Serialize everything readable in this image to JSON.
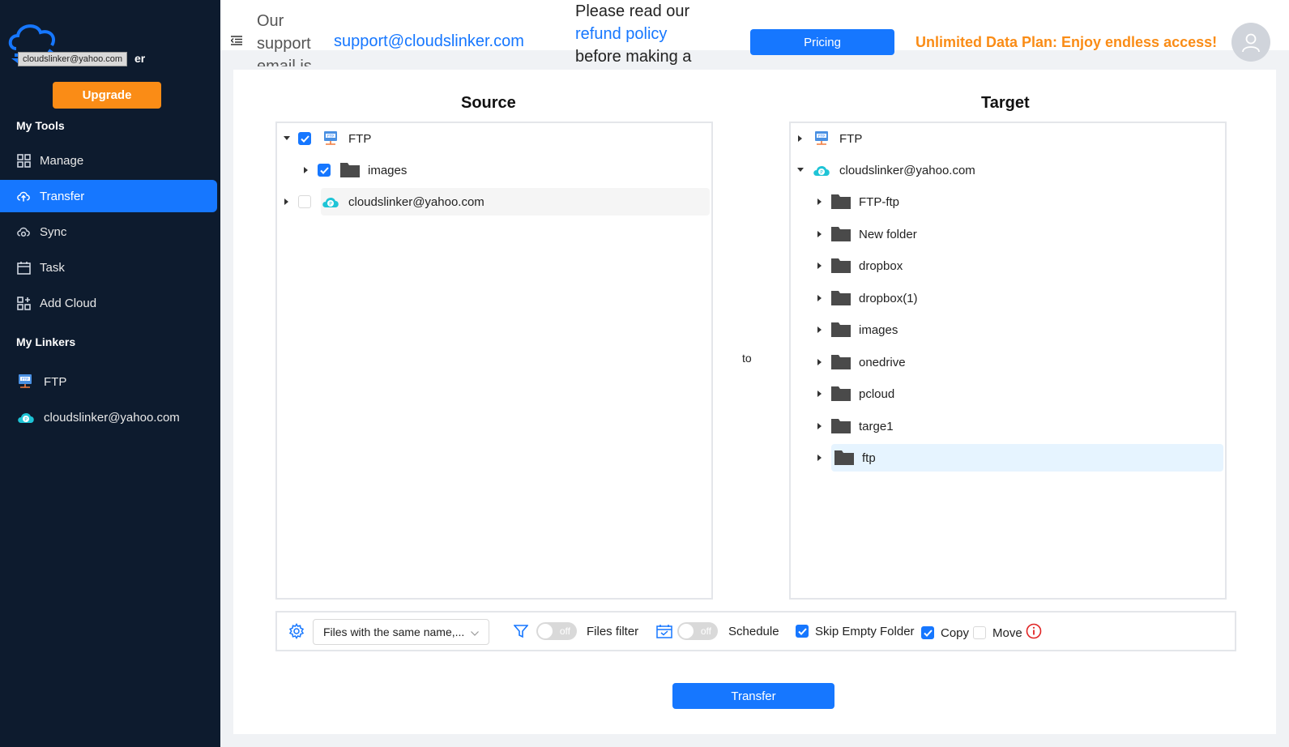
{
  "sidebar": {
    "logo_tooltip": "cloudslinker@yahoo.com",
    "logo_suffix": "er",
    "upgrade_label": "Upgrade",
    "tools_title": "My Tools",
    "nav": [
      {
        "label": "Manage",
        "icon": "grid-icon"
      },
      {
        "label": "Transfer",
        "icon": "cloud-upload-icon",
        "active": true
      },
      {
        "label": "Sync",
        "icon": "cloud-sync-icon"
      },
      {
        "label": "Task",
        "icon": "calendar-icon"
      },
      {
        "label": "Add Cloud",
        "icon": "add-grid-icon"
      }
    ],
    "linkers_title": "My Linkers",
    "linkers": [
      {
        "label": "FTP",
        "icon": "ftp-icon"
      },
      {
        "label": "cloudslinker@yahoo.com",
        "icon": "pcloud-icon"
      }
    ]
  },
  "header": {
    "support_prefix": "Our support email is",
    "support_email": "support@cloudslinker.com",
    "refund_pre": "Please read our",
    "refund_link": "refund policy",
    "refund_post": "before making a",
    "pricing_label": "Pricing",
    "promo": "Unlimited Data Plan: Enjoy endless access!"
  },
  "colors": {
    "accent": "#1677ff",
    "promo": "#fa8c16",
    "sidebar_bg": "#0d1b2e"
  },
  "source": {
    "title": "Source",
    "nodes": [
      {
        "label": "FTP",
        "checked": true,
        "expanded": true,
        "icon": "ftp-icon"
      },
      {
        "label": "images",
        "checked": true,
        "icon": "folder-icon"
      },
      {
        "label": "cloudslinker@yahoo.com",
        "checked": false,
        "icon": "pcloud-icon"
      }
    ]
  },
  "to_label": "to",
  "target": {
    "title": "Target",
    "nodes": [
      {
        "label": "FTP",
        "icon": "ftp-icon"
      },
      {
        "label": "cloudslinker@yahoo.com",
        "icon": "pcloud-icon",
        "expanded": true
      },
      {
        "label": "FTP-ftp",
        "icon": "folder-icon"
      },
      {
        "label": "New folder",
        "icon": "folder-icon"
      },
      {
        "label": "dropbox",
        "icon": "folder-icon"
      },
      {
        "label": "dropbox(1)",
        "icon": "folder-icon"
      },
      {
        "label": "images",
        "icon": "folder-icon"
      },
      {
        "label": "onedrive",
        "icon": "folder-icon"
      },
      {
        "label": "pcloud",
        "icon": "folder-icon"
      },
      {
        "label": "targe1",
        "icon": "folder-icon"
      },
      {
        "label": "ftp",
        "icon": "folder-icon",
        "selected": true
      }
    ]
  },
  "options": {
    "conflict_value": "Files with the same name,...",
    "filter_toggle": "off",
    "filter_label": "Files filter",
    "schedule_toggle": "off",
    "schedule_label": "Schedule",
    "skip_empty_label": "Skip Empty Folder",
    "skip_empty_checked": true,
    "copy_label": "Copy",
    "copy_checked": true,
    "move_label": "Move",
    "move_checked": false
  },
  "transfer_label": "Transfer"
}
